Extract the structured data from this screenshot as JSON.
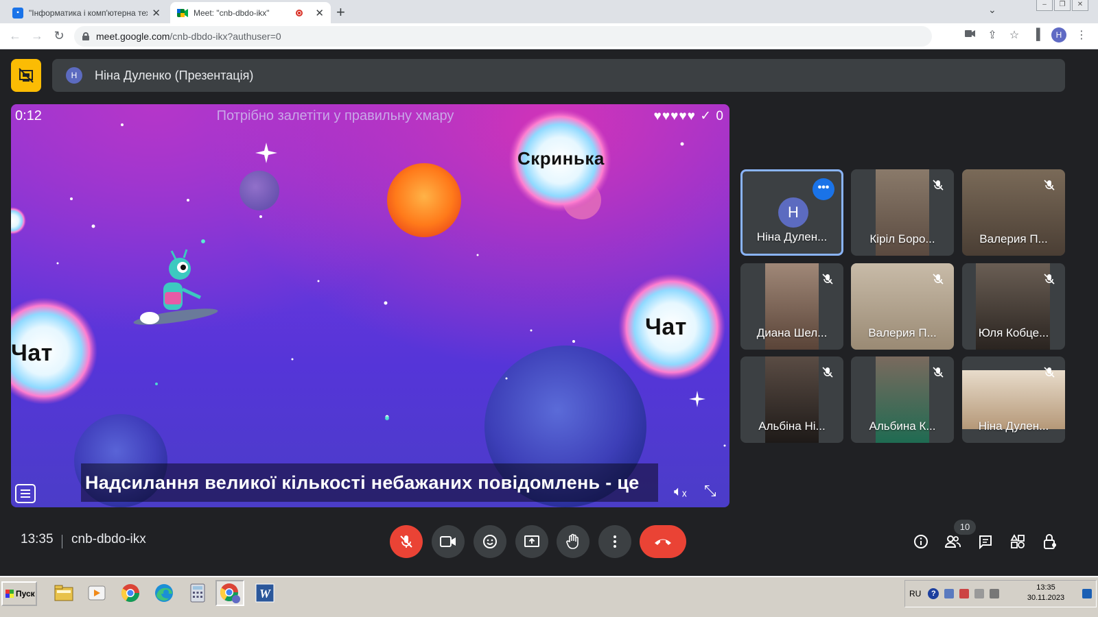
{
  "browser": {
    "tabs": [
      {
        "title": "\"Інформатика і комп'ютерна техні",
        "active": false
      },
      {
        "title": "Meet: \"cnb-dbdo-ikx\"",
        "active": true
      }
    ],
    "url_host": "meet.google.com",
    "url_path": "/cnb-dbdo-ikx?authuser=0",
    "profile_initial": "H",
    "window_controls": [
      "minimize",
      "restore",
      "close"
    ]
  },
  "presentation": {
    "presenter_initial": "Н",
    "presenter_label": "Ніна Дуленко (Презентація)"
  },
  "game": {
    "timer": "0:12",
    "prompt": "Потрібно залетіти у правильну хмару",
    "lives": "♥♥♥♥♥",
    "score": "✓ 0",
    "clouds": [
      "Скринька",
      "Чат",
      "Чат"
    ],
    "subtitle": "Надсилання великої кількості небажаних повідомлень - це"
  },
  "participants": [
    {
      "name": "Ніна Дулен...",
      "initial": "Н",
      "avatar_only": true,
      "highlighted": true
    },
    {
      "name": "Кіріл Боро...",
      "photo_color": "#7d6a5c"
    },
    {
      "name": "Валерия П...",
      "photo_color": "#6d5a4a"
    },
    {
      "name": "Диана Шел...",
      "photo_color": "#8a7266"
    },
    {
      "name": "Валерия П...",
      "photo_color": "#a69784"
    },
    {
      "name": "Юля Кобце...",
      "photo_color": "#4e4440"
    },
    {
      "name": "Альбіна Ні...",
      "photo_color": "#3d3530"
    },
    {
      "name": "Альбина К...",
      "photo_color": "#2f6b55"
    },
    {
      "name": "Ніна Дулен...",
      "photo_color": "#b5967a"
    }
  ],
  "meeting": {
    "time": "13:35",
    "code": "cnb-dbdo-ikx",
    "participant_count": "10"
  },
  "taskbar": {
    "start_label": "Пуск",
    "apps": [
      "explorer-icon",
      "media-icon",
      "chrome-icon",
      "edge-icon",
      "calculator-icon",
      "chrome-active-icon",
      "word-icon"
    ],
    "lang": "RU",
    "time": "13:35",
    "date": "30.11.2023"
  }
}
